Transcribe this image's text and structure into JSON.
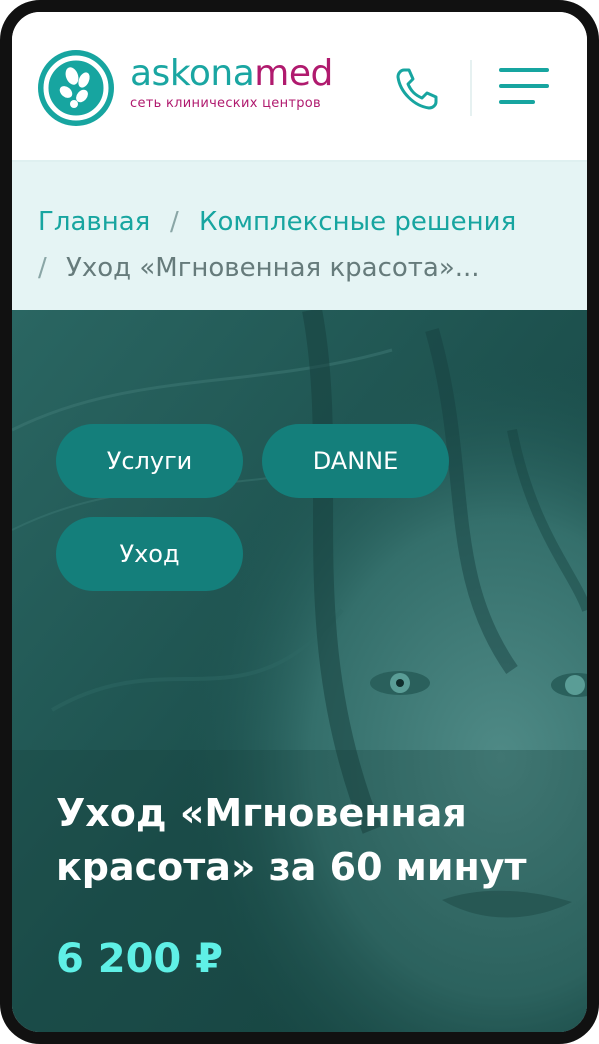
{
  "header": {
    "logo": {
      "word_main": "askona",
      "word_accent": "med",
      "subtitle": "сеть клинических центров"
    },
    "phone_icon": "phone-icon",
    "menu_icon": "hamburger-menu-icon"
  },
  "breadcrumbs": {
    "items": [
      {
        "label": "Главная"
      },
      {
        "label": "Комплексные решения"
      },
      {
        "label": "Уход «Мгновенная красота»..."
      }
    ],
    "separator": "/"
  },
  "hero": {
    "tags": [
      {
        "label": "Услуги"
      },
      {
        "label": "DANNE"
      },
      {
        "label": "Уход"
      }
    ],
    "title": "Уход «Мгновенная красота» за 60 минут",
    "price": "6 200 ₽"
  },
  "colors": {
    "brand_teal": "#17a5a0",
    "brand_magenta": "#b01a6e",
    "breadcrumb_bg": "#e5f4f4",
    "price_accent": "#5ff0e6"
  }
}
